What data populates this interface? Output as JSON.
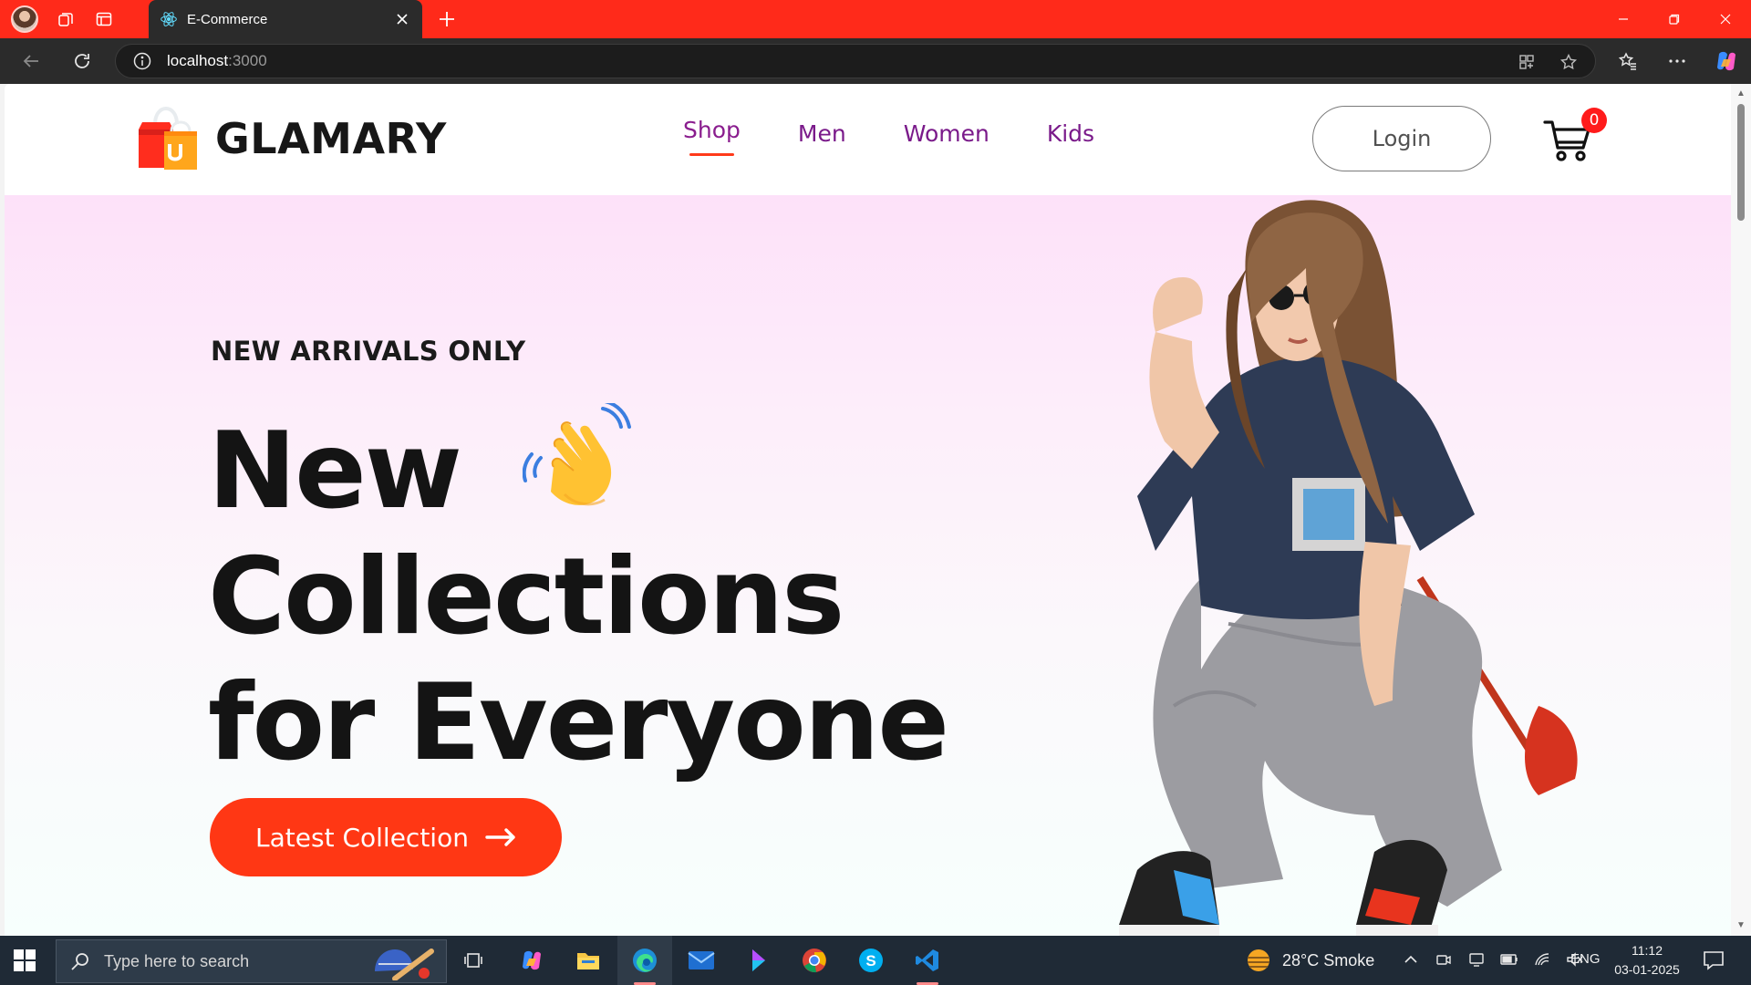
{
  "browser": {
    "tab_title": "E-Commerce",
    "url_host": "localhost",
    "url_port": ":3000"
  },
  "site": {
    "brand": "GLAMARY",
    "nav": [
      {
        "label": "Shop",
        "active": true
      },
      {
        "label": "Men",
        "active": false
      },
      {
        "label": "Women",
        "active": false
      },
      {
        "label": "Kids",
        "active": false
      }
    ],
    "login_label": "Login",
    "cart_count": "0",
    "accent": "#ff3714",
    "nav_color": "#7a1a8a"
  },
  "hero": {
    "eyebrow": "NEW ARRIVALS ONLY",
    "headline_line1": "New",
    "headline_line2": "Collections",
    "headline_line3": "for Everyone",
    "cta_label": "Latest Collection"
  },
  "taskbar": {
    "search_placeholder": "Type here to search",
    "weather": "28°C  Smoke",
    "language": "ENG",
    "time": "11:12",
    "date": "03-01-2025"
  }
}
